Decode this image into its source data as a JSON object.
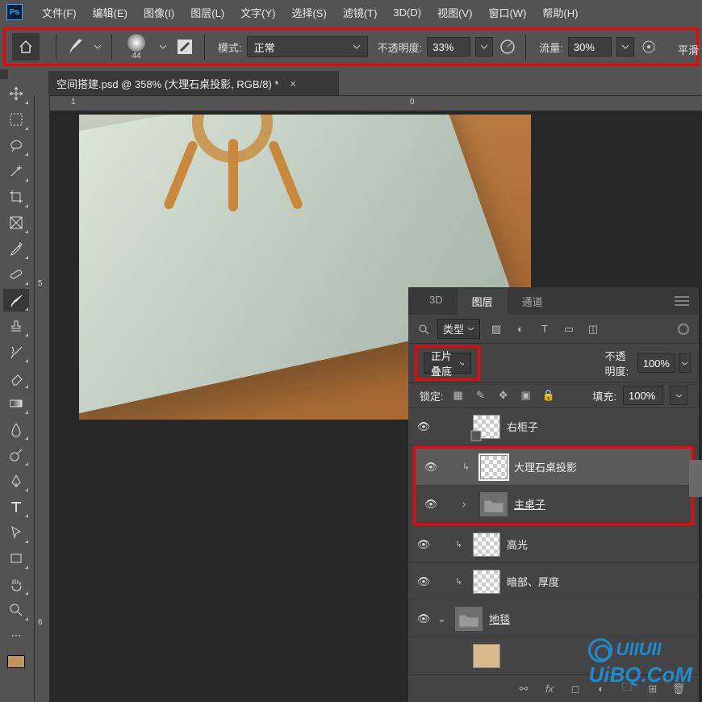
{
  "menu": {
    "file": "文件(F)",
    "edit": "编辑(E)",
    "image": "图像(I)",
    "layer": "图层(L)",
    "type": "文字(Y)",
    "select": "选择(S)",
    "filter": "滤镜(T)",
    "threeD": "3D(D)",
    "view": "视图(V)",
    "window": "窗口(W)",
    "help": "帮助(H)"
  },
  "options": {
    "brush_size": "44",
    "mode_label": "模式:",
    "mode_value": "正常",
    "opacity_label": "不透明度:",
    "opacity_value": "33%",
    "flow_label": "流量:",
    "flow_value": "30%",
    "right_label": "平滑"
  },
  "tab": {
    "name": "空间搭建.psd @ 358% (大理石桌投影, RGB/8) *"
  },
  "ruler": {
    "h1": "1",
    "h2": "0",
    "v5": "5",
    "v6": "6"
  },
  "panel": {
    "tabs": {
      "threeD": "3D",
      "layers": "图层",
      "channels": "通道"
    },
    "filter": {
      "search": "类型"
    },
    "blend": {
      "mode": "正片叠底",
      "opacity_label": "不透明度:",
      "opacity_value": "100%"
    },
    "lock": {
      "label": "锁定:",
      "fill_label": "填充:",
      "fill_value": "100%"
    },
    "layers": [
      {
        "name": "右柜子"
      },
      {
        "name": "大理石桌投影"
      },
      {
        "name": "主桌子"
      },
      {
        "name": "高光"
      },
      {
        "name": "暗部、厚度"
      },
      {
        "name": "地毯"
      }
    ]
  },
  "watermark": {
    "top": "UIIUII",
    "bottom": "UiBQ.CoM"
  }
}
